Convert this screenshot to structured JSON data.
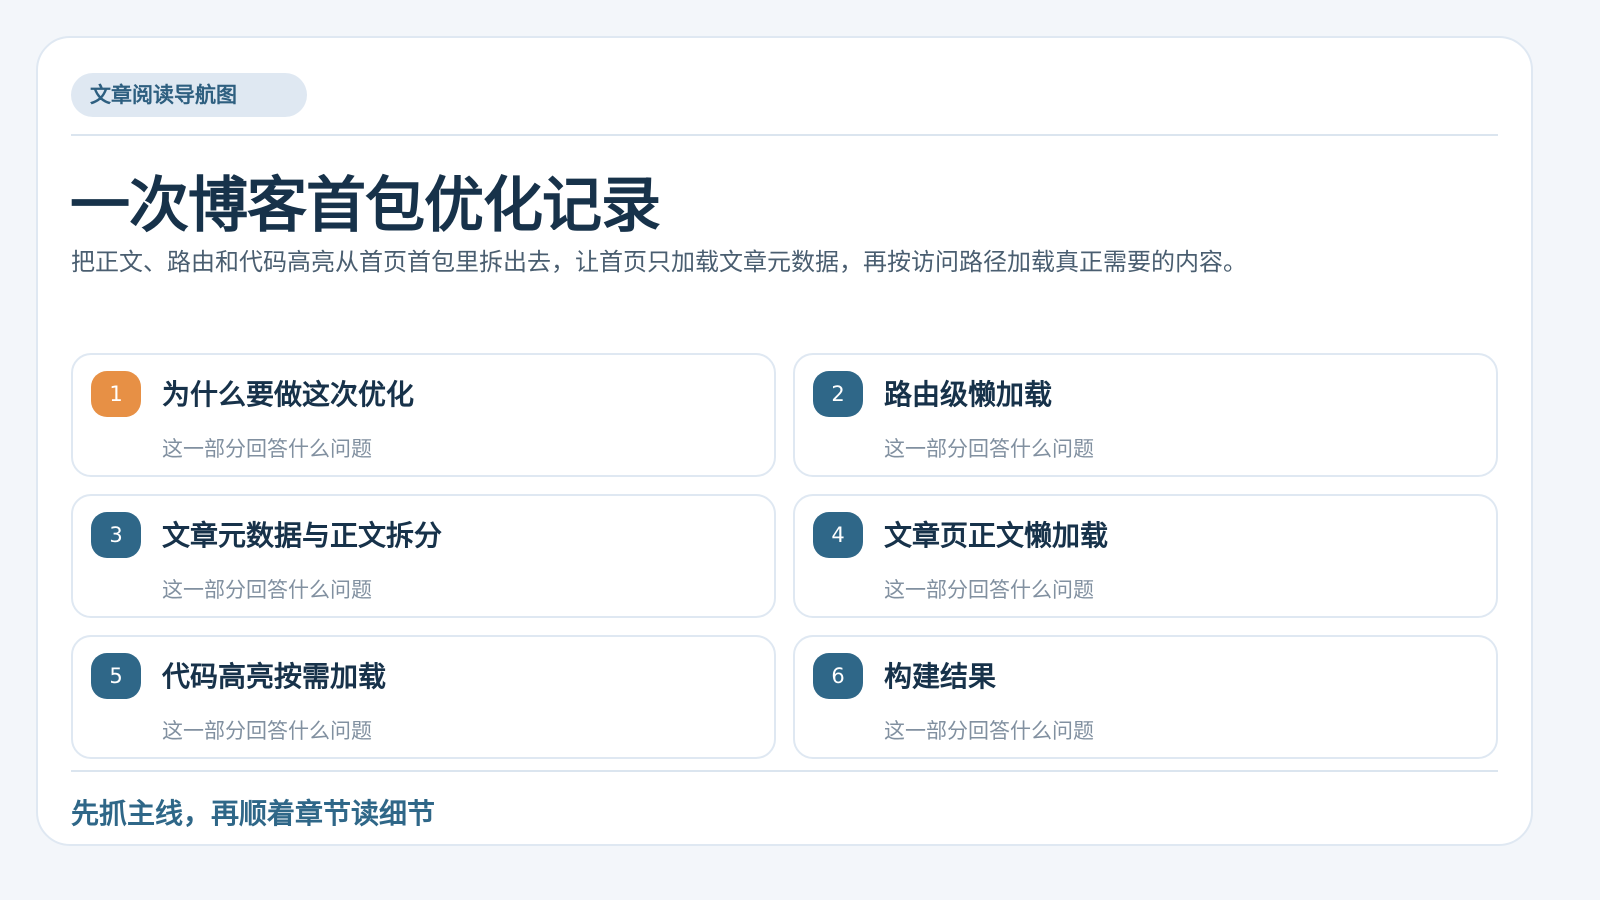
{
  "header": {
    "nav_label": "文章阅读导航图",
    "title": "一次博客首包优化记录",
    "summary": "把正文、路由和代码高亮从首页首包里拆出去，让首页只加载文章元数据，再按访问路径加载真正需要的内容。"
  },
  "sections": [
    {
      "number": "1",
      "title": "为什么要做这次优化",
      "subtitle": "这一部分回答什么问题",
      "badge_color": "#e79045"
    },
    {
      "number": "2",
      "title": "路由级懒加载",
      "subtitle": "这一部分回答什么问题",
      "badge_color": "#2f6788"
    },
    {
      "number": "3",
      "title": "文章元数据与正文拆分",
      "subtitle": "这一部分回答什么问题",
      "badge_color": "#2f6788"
    },
    {
      "number": "4",
      "title": "文章页正文懒加载",
      "subtitle": "这一部分回答什么问题",
      "badge_color": "#2f6788"
    },
    {
      "number": "5",
      "title": "代码高亮按需加载",
      "subtitle": "这一部分回答什么问题",
      "badge_color": "#2f6788"
    },
    {
      "number": "6",
      "title": "构建结果",
      "subtitle": "这一部分回答什么问题",
      "badge_color": "#2f6788"
    }
  ],
  "footer": {
    "note": "先抓主线，再顺着章节读细节"
  },
  "colors": {
    "background": "#f3f6fa",
    "card": "#ffffff",
    "border": "#dfe8f2",
    "title": "#17324a",
    "accent": "#2f6788",
    "highlight": "#e79045"
  }
}
